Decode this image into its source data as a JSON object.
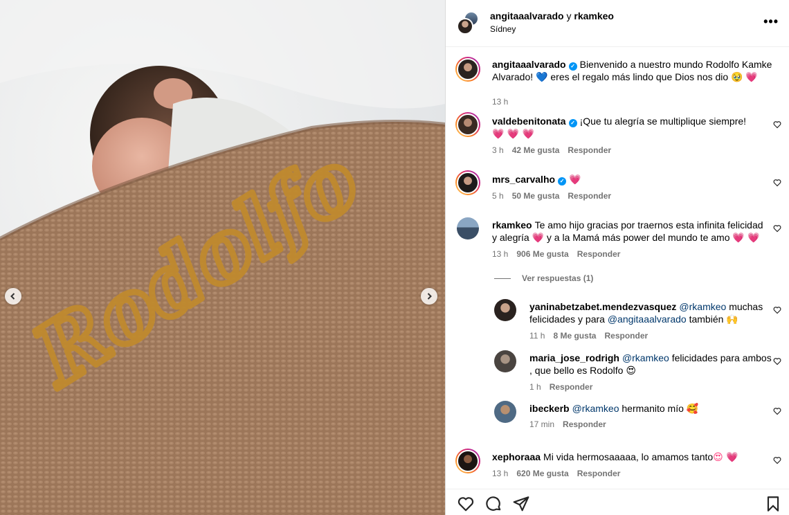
{
  "media": {
    "blanket_text": "Rodolfo",
    "prev_icon": "chevron-left-icon",
    "next_icon": "chevron-right-icon"
  },
  "header": {
    "user1": "angitaaalvarado",
    "joiner": "y",
    "user2": "rkamkeo",
    "location": "Sídney",
    "more_icon": "more-horizontal-icon",
    "more_label": "•••"
  },
  "caption": {
    "user": "angitaaalvarado",
    "text": "Bienvenido a nuestro mundo Rodolfo Kamke Alvarado! ",
    "text2": " eres el regalo más lindo que Dios nos dio ",
    "emoji_blue_heart": "💙",
    "emoji_tear": "🥹",
    "emoji_heart": "💗",
    "time": "13 h"
  },
  "comments": [
    {
      "user": "valdebenitonata",
      "verified": true,
      "text": "¡Que tu alegría se multiplique siempre!",
      "emojis": "💗 💗 💗",
      "time": "3 h",
      "likes": "42 Me gusta",
      "reply": "Responder"
    },
    {
      "user": "mrs_carvalho",
      "verified": true,
      "text": "",
      "emojis": "💗",
      "time": "5 h",
      "likes": "50 Me gusta",
      "reply": "Responder"
    },
    {
      "user": "rkamkeo",
      "verified": false,
      "text_a": "Te amo hijo gracias por traernos esta infinita felicidad y alegría ",
      "emoji_a": "💗",
      "text_b": " y a la Mamá más power del mundo te amo ",
      "emoji_b": "💗 💗",
      "time": "13 h",
      "likes": "906 Me gusta",
      "reply": "Responder",
      "view_replies": "Ver respuestas (1)"
    },
    {
      "user": "yaninabetzabet.mendezvasquez",
      "mention": "@rkamkeo",
      "text_a": " muchas felicidades y para ",
      "mention2": "@angitaaalvarado",
      "text_b": " también ",
      "emoji": "🙌",
      "time": "11 h",
      "likes": "8 Me gusta",
      "reply": "Responder"
    },
    {
      "user": "maria_jose_rodrigh",
      "mention": "@rkamkeo",
      "text": " felicidades para ambos , que bello es Rodolfo ",
      "emoji": "😍",
      "time": "1 h",
      "reply": "Responder"
    },
    {
      "user": "ibeckerb",
      "mention": "@rkamkeo",
      "text": " hermanito mío ",
      "emoji": "🥰",
      "time": "17 min",
      "reply": "Responder"
    },
    {
      "user": "xephoraaa",
      "text": "Mi vida hermosaaaaa, lo amamos tanto",
      "emoji": "😍 💗",
      "time": "13 h",
      "likes": "620 Me gusta",
      "reply": "Responder"
    }
  ],
  "actions": {
    "like_icon": "heart-outline-icon",
    "comment_icon": "comment-bubble-icon",
    "share_icon": "paper-plane-icon",
    "save_icon": "bookmark-icon"
  },
  "colors": {
    "blanket": "#9a7458",
    "embroidery": "#c08a2e",
    "verified": "#0095f6",
    "meta_gray": "#737373"
  }
}
